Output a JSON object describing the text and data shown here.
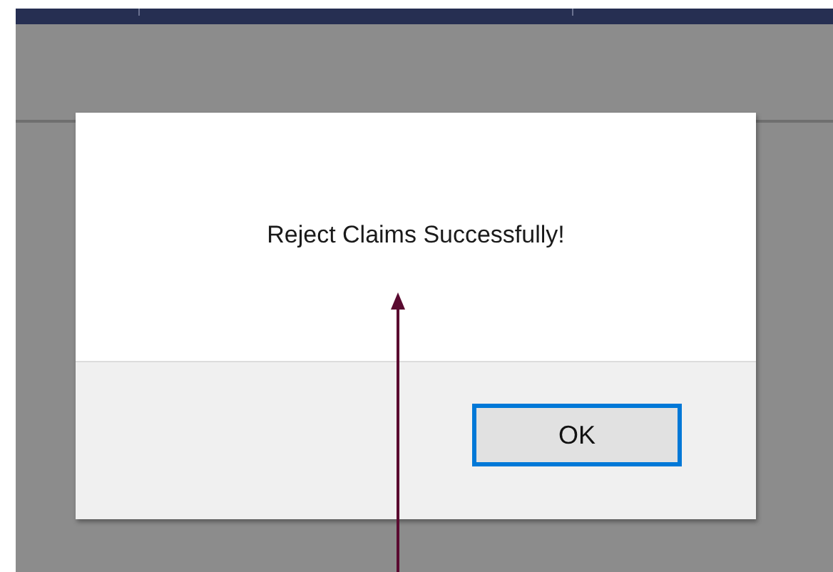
{
  "dialog": {
    "message": "Reject Claims Successfully!",
    "buttons": [
      {
        "label": "OK",
        "focused": true
      }
    ]
  }
}
